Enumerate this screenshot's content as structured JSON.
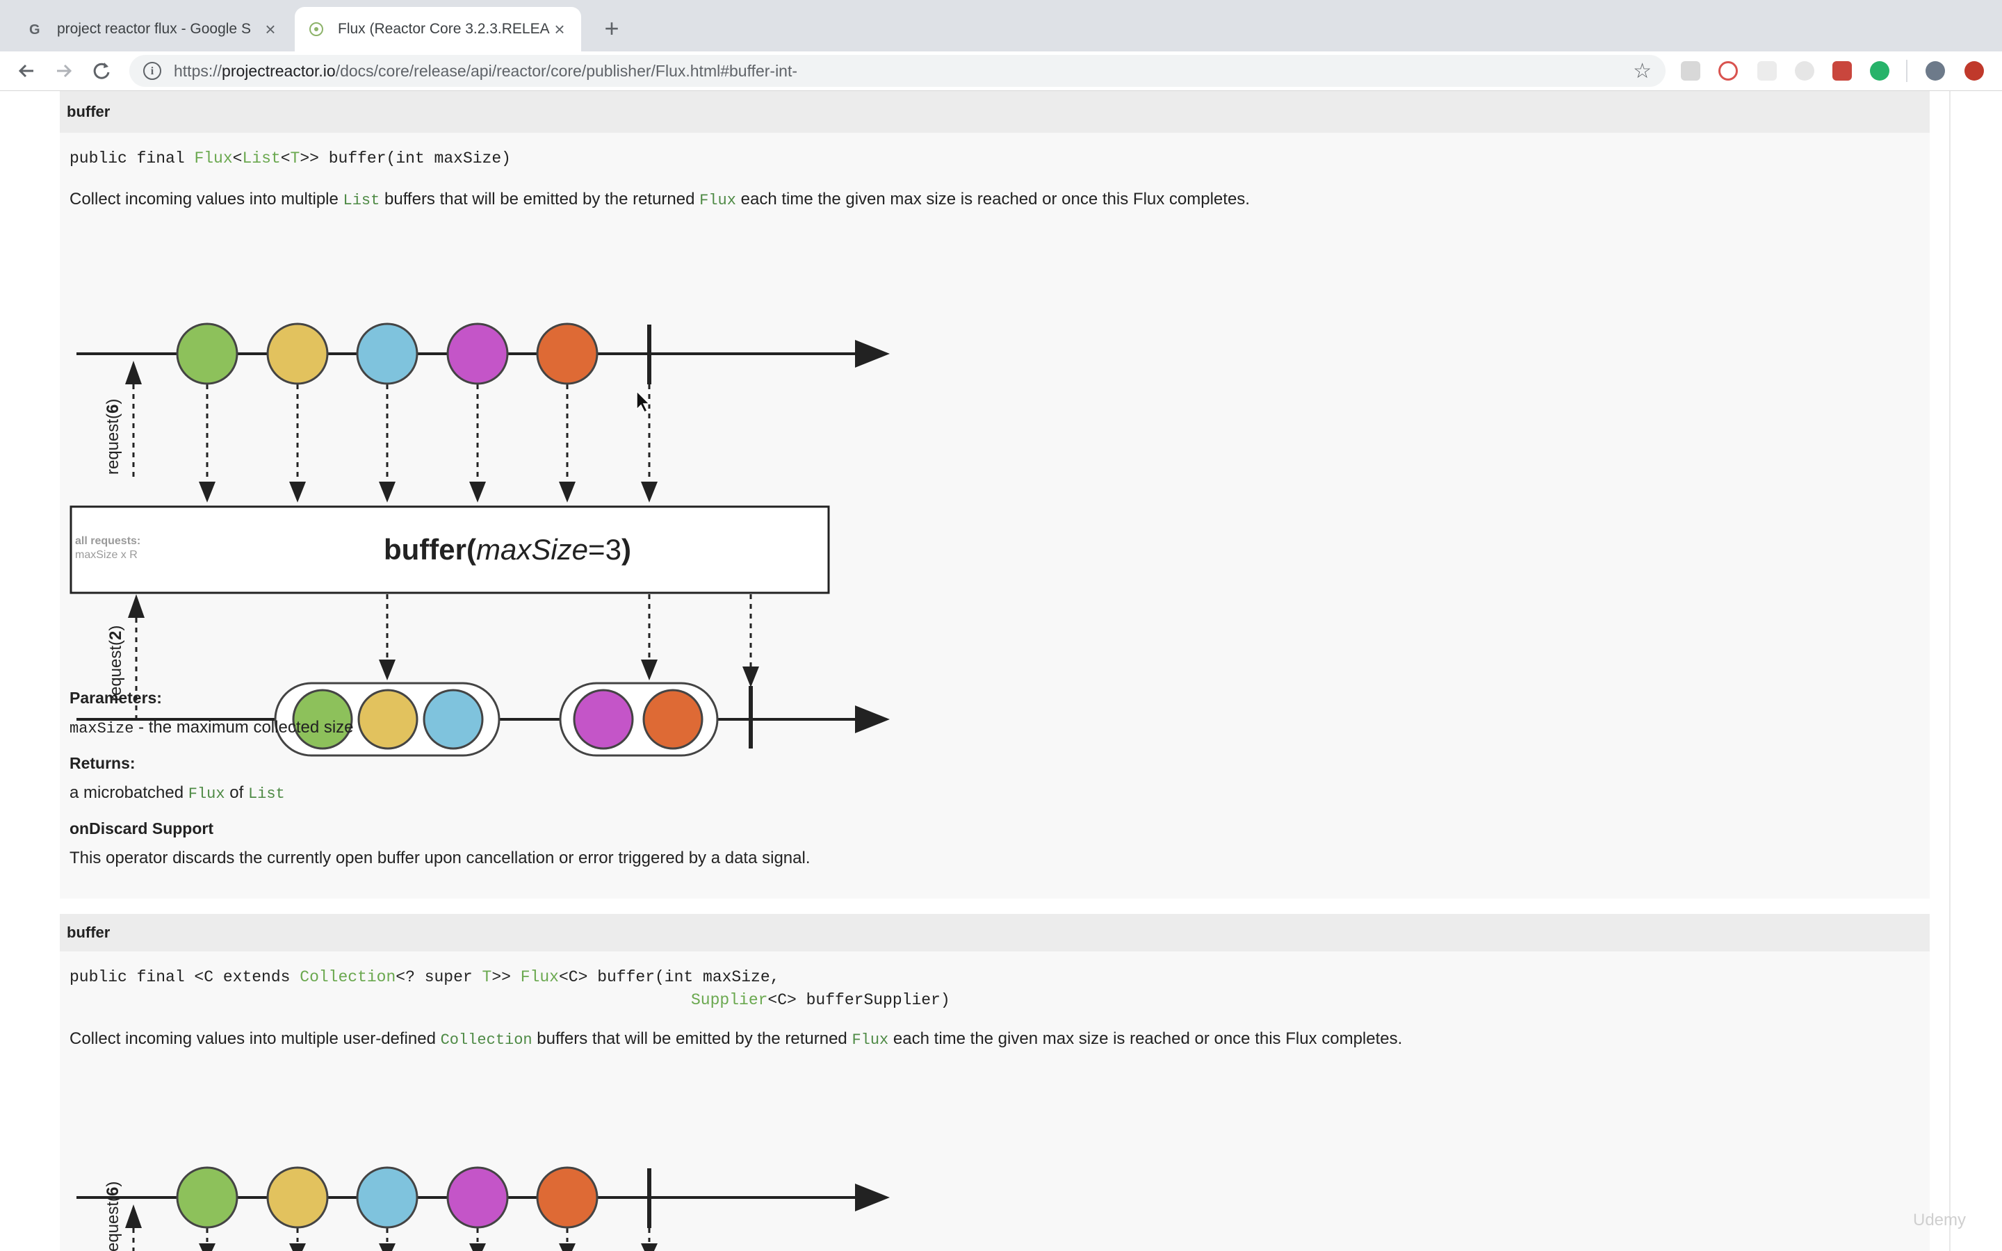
{
  "browser": {
    "tabs": [
      {
        "title": "project reactor flux - Google S",
        "active": false
      },
      {
        "title": "Flux (Reactor Core 3.2.3.RELEA",
        "active": true
      }
    ],
    "url_scheme": "https://",
    "url_host": "projectreactor.io",
    "url_path": "/docs/core/release/api/reactor/core/publisher/Flux.html#buffer-int-"
  },
  "section1": {
    "heading": "buffer",
    "signature": {
      "p1": "public final ",
      "t1": "Flux",
      "p2": "<",
      "t2": "List",
      "p3": "<",
      "t3": "T",
      "p4": ">> buffer(int maxSize)"
    },
    "description": {
      "a": "Collect incoming values into multiple ",
      "code1": "List",
      "b": " buffers that will be emitted by the returned ",
      "code2": "Flux",
      "c": " each time the given max size is reached or once this Flux completes."
    },
    "diagram": {
      "request_top": "request(",
      "request_top_n": "6",
      "request_top_close": ")",
      "request_bottom": "request(",
      "request_bottom_n": "2",
      "request_bottom_close": ")",
      "box_note_1": "all requests:",
      "box_note_2": "maxSize x R",
      "op_name": "buffer(",
      "op_arg": "maxSize",
      "op_eq": "=3",
      "op_close": ")"
    },
    "parameters_label": "Parameters:",
    "param_name": "maxSize",
    "param_desc": " - the maximum collected size",
    "returns_label": "Returns:",
    "returns_a": "a microbatched ",
    "returns_code1": "Flux",
    "returns_b": " of ",
    "returns_code2": "List",
    "ondiscard_label": "onDiscard Support",
    "ondiscard_text": "This operator discards the currently open buffer upon cancellation or error triggered by a data signal."
  },
  "section2": {
    "heading": "buffer",
    "signature_line1": {
      "p1": "public final <C extends ",
      "t1": "Collection",
      "p2": "<? super ",
      "t2": "T",
      "p3": ">> ",
      "t3": "Flux",
      "p4": "<C> buffer(int maxSize,"
    },
    "signature_line2": {
      "t1": "Supplier",
      "p1": "<C> bufferSupplier)"
    },
    "description": {
      "a": "Collect incoming values into multiple user-defined ",
      "code1": "Collection",
      "b": " buffers that will be emitted by the returned ",
      "code2": "Flux",
      "c": " each time the given max size is reached or once this Flux completes."
    },
    "diagram": {
      "request_top": "request(",
      "request_top_n": "6",
      "request_top_close": ")"
    }
  },
  "marble_colors": [
    "#8dc15b",
    "#e2c25e",
    "#7fc3dd",
    "#c455c8",
    "#de6a35"
  ],
  "watermark": "Udemy"
}
